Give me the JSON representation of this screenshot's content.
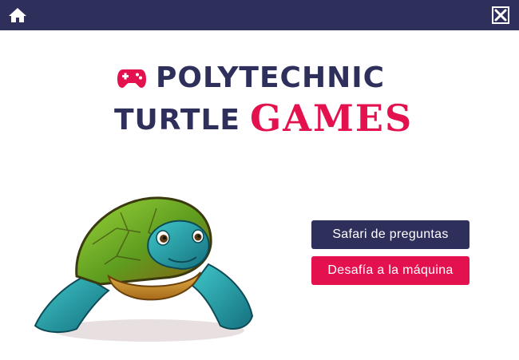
{
  "header": {
    "home_icon": "home-icon",
    "close_icon": "close-icon"
  },
  "logo": {
    "line1": "POLYTECHNIC",
    "line2_left": "TURTLE",
    "line2_right": "GAMES",
    "icon": "gamepad-icon"
  },
  "menu": {
    "safari_label": "Safari de preguntas",
    "machine_label": "Desafía a la máquina"
  },
  "colors": {
    "navy": "#2f2f5c",
    "accent": "#e3124f",
    "background": "#ffffff"
  }
}
